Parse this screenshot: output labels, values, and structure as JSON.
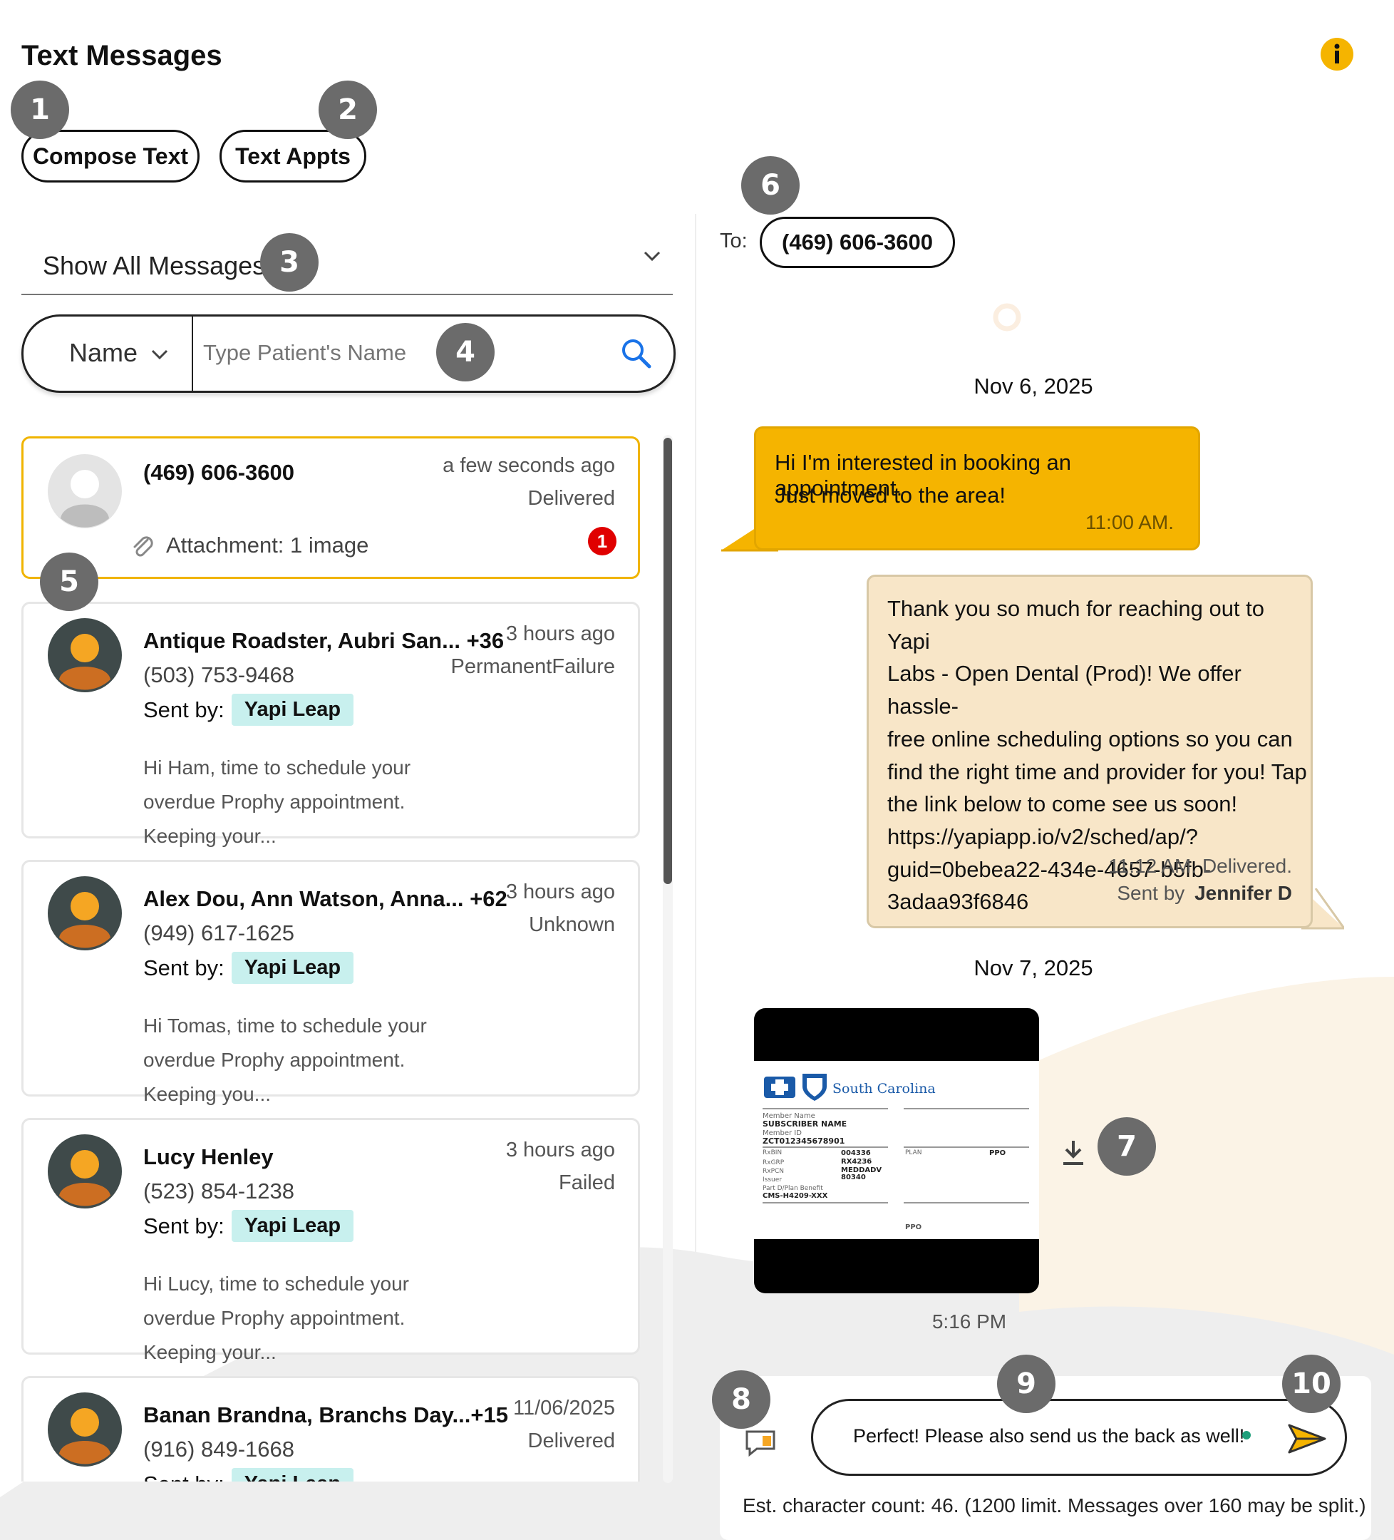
{
  "header": {
    "title": "Text Messages"
  },
  "actions": {
    "compose": "Compose Text",
    "appts": "Text Appts"
  },
  "filter": {
    "selected": "Show All Messages"
  },
  "search": {
    "type_selected": "Name",
    "placeholder": "Type Patient's Name"
  },
  "conversations": [
    {
      "name": "(469) 606-3600",
      "time": "a few seconds ago",
      "status": "Delivered",
      "attachment": "Attachment: 1 image",
      "unread": "1"
    },
    {
      "name": "Antique Roadster, Aubri San... +36",
      "phone": "(503) 753-9468",
      "sent_by_label": "Sent by:",
      "sent_by": "Yapi Leap",
      "time": "3 hours ago",
      "status": "PermanentFailure",
      "preview": "Hi Ham, time to schedule your overdue Prophy appointment. Keeping your..."
    },
    {
      "name": "Alex Dou, Ann Watson, Anna... +62",
      "phone": "(949) 617-1625",
      "sent_by_label": "Sent by:",
      "sent_by": "Yapi Leap",
      "time": "3 hours ago",
      "status": "Unknown",
      "preview": "Hi Tomas, time to schedule your overdue Prophy appointment. Keeping you..."
    },
    {
      "name": "Lucy Henley",
      "phone": "(523) 854-1238",
      "sent_by_label": "Sent by:",
      "sent_by": "Yapi Leap",
      "time": "3 hours ago",
      "status": "Failed",
      "preview": "Hi Lucy, time to schedule your overdue Prophy appointment. Keeping your..."
    },
    {
      "name": "Banan Brandna, Branchs Day...+15",
      "phone": "(916) 849-1668",
      "sent_by_label": "Sent by:",
      "sent_by": "Yapi Leap",
      "time": "11/06/2025",
      "status": "Delivered"
    }
  ],
  "thread": {
    "to_label": "To:",
    "to_number": "(469) 606-3600",
    "date1": "Nov 6, 2025",
    "incoming": {
      "line1": "Hi I'm interested in booking an appointment.",
      "line2": "Just moved to the area!",
      "time": "11:00 AM."
    },
    "outgoing": {
      "lines": [
        "Thank you so much for reaching out to Yapi",
        "Labs - Open Dental (Prod)! We offer hassle-",
        "free online scheduling options so you can",
        "find the right time and provider for you! Tap",
        "the link below to come see us soon!",
        "https://yapiapp.io/v2/sched/ap/?",
        "guid=0bebea22-434e-4657-b5fb-",
        "3adaa93f6846"
      ],
      "meta": "11:12 AM. Delivered.",
      "sent_by_label": "Sent by",
      "sent_by": "Jennifer D"
    },
    "date2": "Nov 7, 2025",
    "image_time": "5:16 PM",
    "card": {
      "brand": "South Carolina",
      "member_name_label": "Member Name",
      "member_name": "SUBSCRIBER NAME",
      "member_id_label": "Member ID",
      "member_id": "ZCT012345678901",
      "rxbin_label": "RxBIN",
      "rxbin": "004336",
      "rxgrp_label": "RxGRP",
      "rxgrp": "RX4236",
      "rxpcn_label": "RxPCN",
      "rxpcn": "MEDDADV",
      "issuer_label": "Issuer",
      "issuer": "80340",
      "partd_label": "Part D/Plan Benefit",
      "partd": "CMS-H4209-XXX",
      "plan_label": "PLAN",
      "plan": "PPO",
      "ppo_logo": "PPO"
    }
  },
  "composer": {
    "value": "Perfect! Please also send us the back as well!",
    "char_count": "Est. character count: 46. (1200 limit. Messages over 160 may be split.)"
  },
  "badges": [
    "1",
    "2",
    "3",
    "4",
    "5",
    "6",
    "7",
    "8",
    "9",
    "10"
  ],
  "colors": {
    "accent": "#f5b400",
    "outgoing_bg": "#f8e6c8",
    "tag_bg": "#c8f0ee",
    "badge": "#6b6b6b",
    "unread": "#e00000"
  }
}
